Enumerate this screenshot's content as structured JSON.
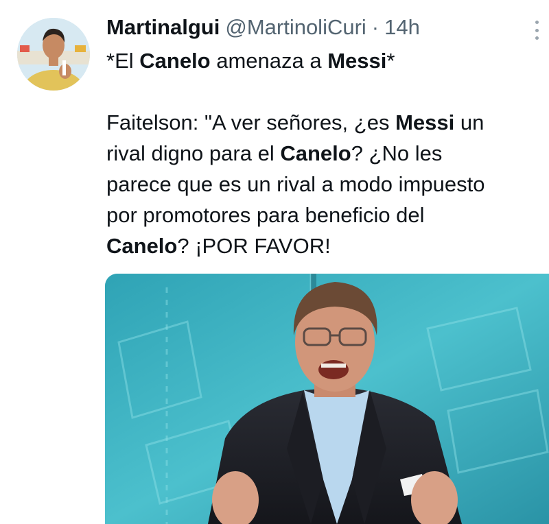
{
  "tweet": {
    "display_name": "Martinalgui",
    "handle": "@MartinoliCuri",
    "separator": "·",
    "time": "14h",
    "more_icon": "more-vertical-icon",
    "avatar_icon": "avatar",
    "text": {
      "line1": {
        "a": "*El ",
        "b": "Canelo",
        "c": " amenaza a ",
        "d": "Messi",
        "e": "*"
      },
      "line3": {
        "a": "Faitelson: \"A ver señores, ¿es ",
        "b": "Messi",
        "c": " un"
      },
      "line4": {
        "a": "rival digno para el ",
        "b": "Canelo",
        "c": "? ¿No les"
      },
      "line5": "parece que es un rival a modo impuesto",
      "line6": "por promotores para beneficio del",
      "line7": {
        "b": "Canelo",
        "c": "? ¡POR FAVOR!"
      }
    },
    "media": {
      "kind": "photo",
      "description_icon": "tv-presenter-photo"
    }
  },
  "colors": {
    "text": "#0f1419",
    "secondary": "#536471",
    "media_bg": "#3fb0bf"
  }
}
